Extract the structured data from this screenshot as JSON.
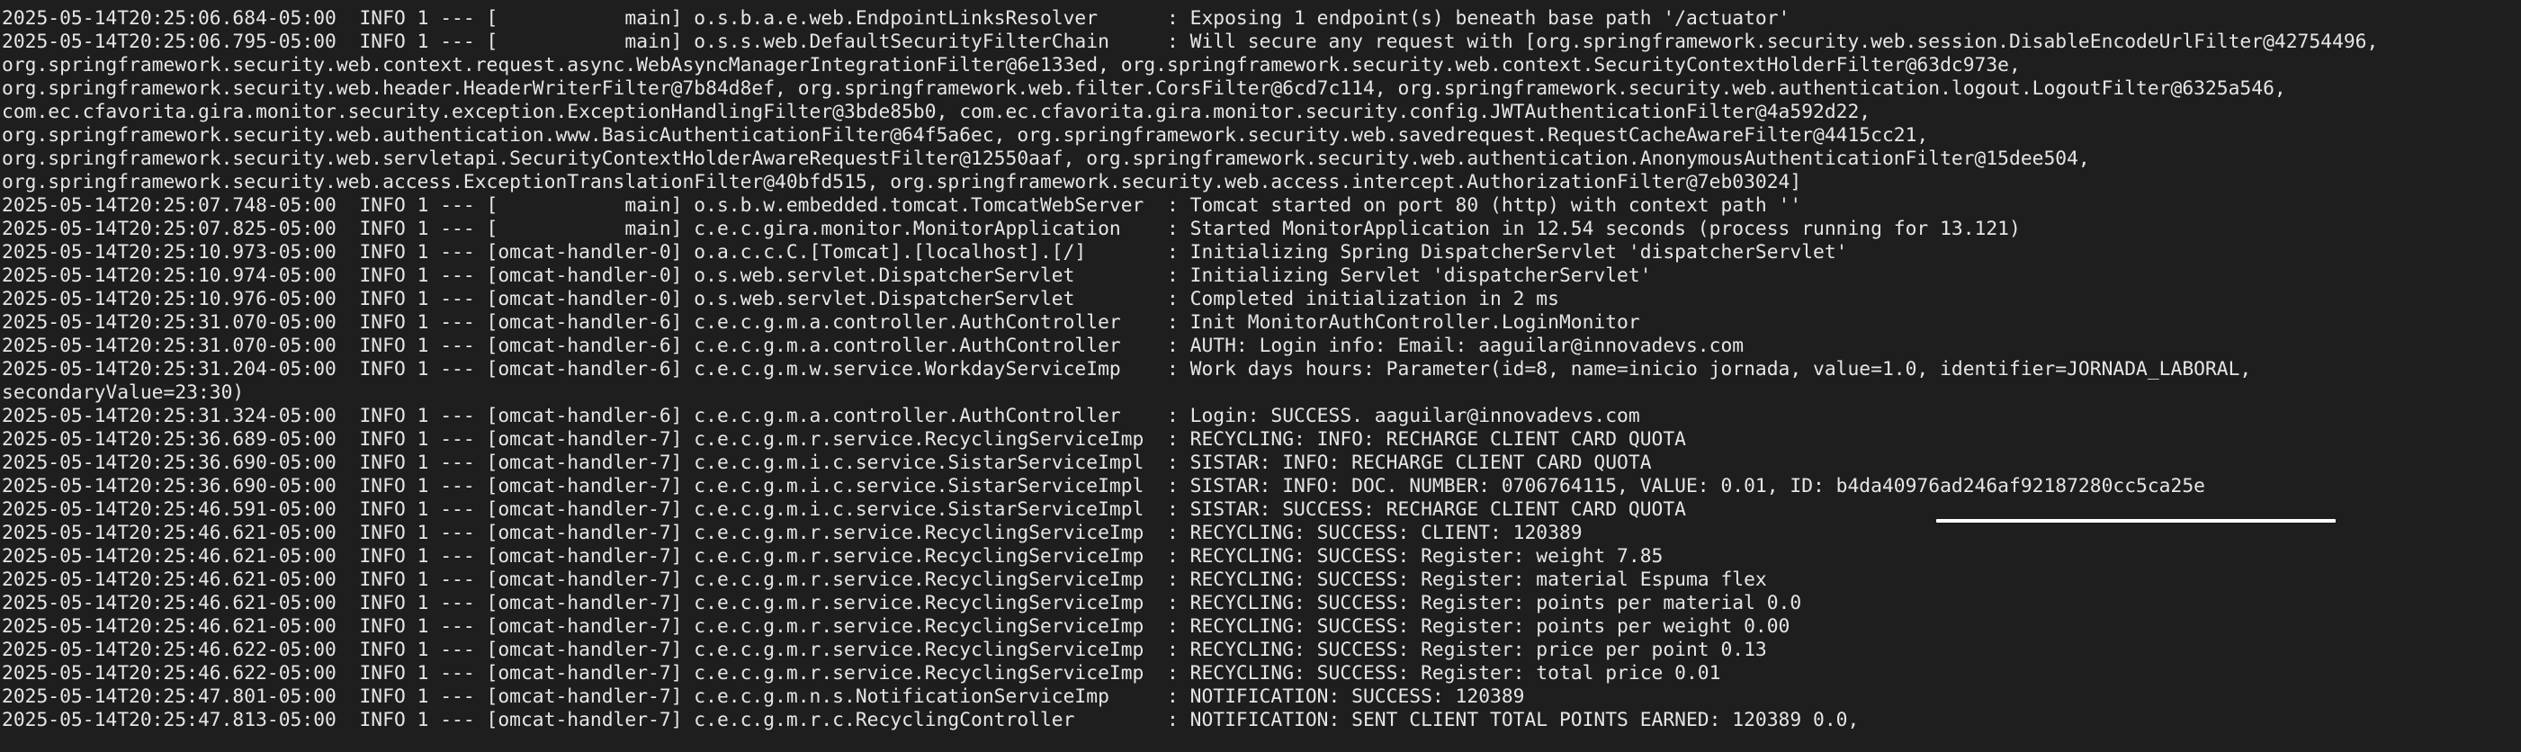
{
  "terminal": {
    "lines": [
      "2025-05-14T20:25:06.684-05:00  INFO 1 --- [           main] o.s.b.a.e.web.EndpointLinksResolver      : Exposing 1 endpoint(s) beneath base path '/actuator'",
      "2025-05-14T20:25:06.795-05:00  INFO 1 --- [           main] o.s.s.web.DefaultSecurityFilterChain     : Will secure any request with [org.springframework.security.web.session.DisableEncodeUrlFilter@42754496,",
      "org.springframework.security.web.context.request.async.WebAsyncManagerIntegrationFilter@6e133ed, org.springframework.security.web.context.SecurityContextHolderFilter@63dc973e,",
      "org.springframework.security.web.header.HeaderWriterFilter@7b84d8ef, org.springframework.web.filter.CorsFilter@6cd7c114, org.springframework.security.web.authentication.logout.LogoutFilter@6325a546,",
      "com.ec.cfavorita.gira.monitor.security.exception.ExceptionHandlingFilter@3bde85b0, com.ec.cfavorita.gira.monitor.security.config.JWTAuthenticationFilter@4a592d22,",
      "org.springframework.security.web.authentication.www.BasicAuthenticationFilter@64f5a6ec, org.springframework.security.web.savedrequest.RequestCacheAwareFilter@4415cc21,",
      "org.springframework.security.web.servletapi.SecurityContextHolderAwareRequestFilter@12550aaf, org.springframework.security.web.authentication.AnonymousAuthenticationFilter@15dee504,",
      "org.springframework.security.web.access.ExceptionTranslationFilter@40bfd515, org.springframework.security.web.access.intercept.AuthorizationFilter@7eb03024]",
      "2025-05-14T20:25:07.748-05:00  INFO 1 --- [           main] o.s.b.w.embedded.tomcat.TomcatWebServer  : Tomcat started on port 80 (http) with context path ''",
      "2025-05-14T20:25:07.825-05:00  INFO 1 --- [           main] c.e.c.gira.monitor.MonitorApplication    : Started MonitorApplication in 12.54 seconds (process running for 13.121)",
      "2025-05-14T20:25:10.973-05:00  INFO 1 --- [omcat-handler-0] o.a.c.c.C.[Tomcat].[localhost].[/]       : Initializing Spring DispatcherServlet 'dispatcherServlet'",
      "2025-05-14T20:25:10.974-05:00  INFO 1 --- [omcat-handler-0] o.s.web.servlet.DispatcherServlet        : Initializing Servlet 'dispatcherServlet'",
      "2025-05-14T20:25:10.976-05:00  INFO 1 --- [omcat-handler-0] o.s.web.servlet.DispatcherServlet        : Completed initialization in 2 ms",
      "2025-05-14T20:25:31.070-05:00  INFO 1 --- [omcat-handler-6] c.e.c.g.m.a.controller.AuthController    : Init MonitorAuthController.LoginMonitor",
      "2025-05-14T20:25:31.070-05:00  INFO 1 --- [omcat-handler-6] c.e.c.g.m.a.controller.AuthController    : AUTH: Login info: Email: aaguilar@innovadevs.com",
      "2025-05-14T20:25:31.204-05:00  INFO 1 --- [omcat-handler-6] c.e.c.g.m.w.service.WorkdayServiceImp    : Work days hours: Parameter(id=8, name=inicio jornada, value=1.0, identifier=JORNADA_LABORAL,",
      "secondaryValue=23:30)",
      "2025-05-14T20:25:31.324-05:00  INFO 1 --- [omcat-handler-6] c.e.c.g.m.a.controller.AuthController    : Login: SUCCESS. aaguilar@innovadevs.com",
      "2025-05-14T20:25:36.689-05:00  INFO 1 --- [omcat-handler-7] c.e.c.g.m.r.service.RecyclingServiceImp  : RECYCLING: INFO: RECHARGE CLIENT CARD QUOTA",
      "2025-05-14T20:25:36.690-05:00  INFO 1 --- [omcat-handler-7] c.e.c.g.m.i.c.service.SistarServiceImpl  : SISTAR: INFO: RECHARGE CLIENT CARD QUOTA",
      "2025-05-14T20:25:36.690-05:00  INFO 1 --- [omcat-handler-7] c.e.c.g.m.i.c.service.SistarServiceImpl  : SISTAR: INFO: DOC. NUMBER: 0706764115, VALUE: 0.01, ID: b4da40976ad246af92187280cc5ca25e",
      "2025-05-14T20:25:46.591-05:00  INFO 1 --- [omcat-handler-7] c.e.c.g.m.i.c.service.SistarServiceImpl  : SISTAR: SUCCESS: RECHARGE CLIENT CARD QUOTA",
      "2025-05-14T20:25:46.621-05:00  INFO 1 --- [omcat-handler-7] c.e.c.g.m.r.service.RecyclingServiceImp  : RECYCLING: SUCCESS: CLIENT: 120389",
      "2025-05-14T20:25:46.621-05:00  INFO 1 --- [omcat-handler-7] c.e.c.g.m.r.service.RecyclingServiceImp  : RECYCLING: SUCCESS: Register: weight 7.85",
      "2025-05-14T20:25:46.621-05:00  INFO 1 --- [omcat-handler-7] c.e.c.g.m.r.service.RecyclingServiceImp  : RECYCLING: SUCCESS: Register: material Espuma flex",
      "2025-05-14T20:25:46.621-05:00  INFO 1 --- [omcat-handler-7] c.e.c.g.m.r.service.RecyclingServiceImp  : RECYCLING: SUCCESS: Register: points per material 0.0",
      "2025-05-14T20:25:46.621-05:00  INFO 1 --- [omcat-handler-7] c.e.c.g.m.r.service.RecyclingServiceImp  : RECYCLING: SUCCESS: Register: points per weight 0.00",
      "2025-05-14T20:25:46.622-05:00  INFO 1 --- [omcat-handler-7] c.e.c.g.m.r.service.RecyclingServiceImp  : RECYCLING: SUCCESS: Register: price per point 0.13",
      "2025-05-14T20:25:46.622-05:00  INFO 1 --- [omcat-handler-7] c.e.c.g.m.r.service.RecyclingServiceImp  : RECYCLING: SUCCESS: Register: total price 0.01",
      "2025-05-14T20:25:47.801-05:00  INFO 1 --- [omcat-handler-7] c.e.c.g.m.n.s.NotificationServiceImp     : NOTIFICATION: SUCCESS: 120389",
      "2025-05-14T20:25:47.813-05:00  INFO 1 --- [omcat-handler-7] c.e.c.g.m.r.c.RecyclingController        : NOTIFICATION: SENT CLIENT TOTAL POINTS EARNED: 120389 0.0,"
    ]
  },
  "colors": {
    "background": "#1e1e1e",
    "text": "#e6e6e6",
    "highlight_underline": "#ffffff"
  }
}
